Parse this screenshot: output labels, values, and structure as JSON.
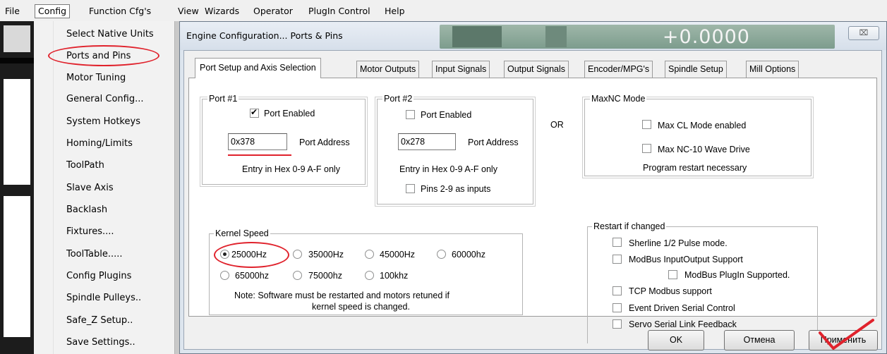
{
  "menubar": {
    "items": [
      "File",
      "Config",
      "Function Cfg's",
      "View",
      "Wizards",
      "Operator",
      "PlugIn Control",
      "Help"
    ]
  },
  "config_menu": {
    "items": [
      "Select Native Units",
      "Ports and Pins",
      "Motor Tuning",
      "General Config...",
      "System Hotkeys",
      "Homing/Limits",
      "ToolPath",
      "Slave Axis",
      "Backlash",
      "Fixtures....",
      "ToolTable.....",
      "Config Plugins",
      "Spindle Pulleys..",
      "Safe_Z Setup..",
      "Save Settings.."
    ],
    "highlighted": "Ports and Pins"
  },
  "dialog": {
    "title": "Engine Configuration... Ports & Pins",
    "background_readout": "+0.0000",
    "close_label": "⌧"
  },
  "tabs": [
    "Port Setup and Axis Selection",
    "Motor Outputs",
    "Input Signals",
    "Output Signals",
    "Encoder/MPG's",
    "Spindle Setup",
    "Mill Options"
  ],
  "port1": {
    "title": "Port #1",
    "enabled_label": "Port Enabled",
    "enabled": true,
    "address": "0x378",
    "address_label": "Port Address",
    "hint": "Entry in Hex 0-9 A-F only"
  },
  "port2": {
    "title": "Port #2",
    "enabled_label": "Port Enabled",
    "enabled": false,
    "address": "0x278",
    "address_label": "Port Address",
    "hint": "Entry in Hex 0-9 A-F only",
    "inputs_label": "Pins 2-9 as inputs"
  },
  "or_label": "OR",
  "maxnc": {
    "title": "MaxNC Mode",
    "options": [
      "Max CL Mode enabled",
      "Max NC-10 Wave Drive"
    ],
    "note": "Program restart necessary"
  },
  "kernel": {
    "title": "Kernel Speed",
    "options": [
      "25000Hz",
      "35000Hz",
      "45000Hz",
      "60000hz",
      "65000hz",
      "75000hz",
      "100khz"
    ],
    "selected": "25000Hz",
    "note_line1": "Note: Software must be restarted and motors retuned if",
    "note_line2": "kernel speed is changed."
  },
  "restart": {
    "title": "Restart if changed",
    "options": [
      "Sherline 1/2 Pulse mode.",
      "ModBus InputOutput Support",
      "ModBus PlugIn Supported.",
      "TCP Modbus support",
      "Event Driven Serial Control",
      "Servo Serial Link Feedback"
    ]
  },
  "buttons": {
    "ok": "OK",
    "cancel": "Отмена",
    "apply": "Применить"
  },
  "colors": {
    "annotation_red": "#e0222c",
    "window_frame": "#dde5ee"
  }
}
